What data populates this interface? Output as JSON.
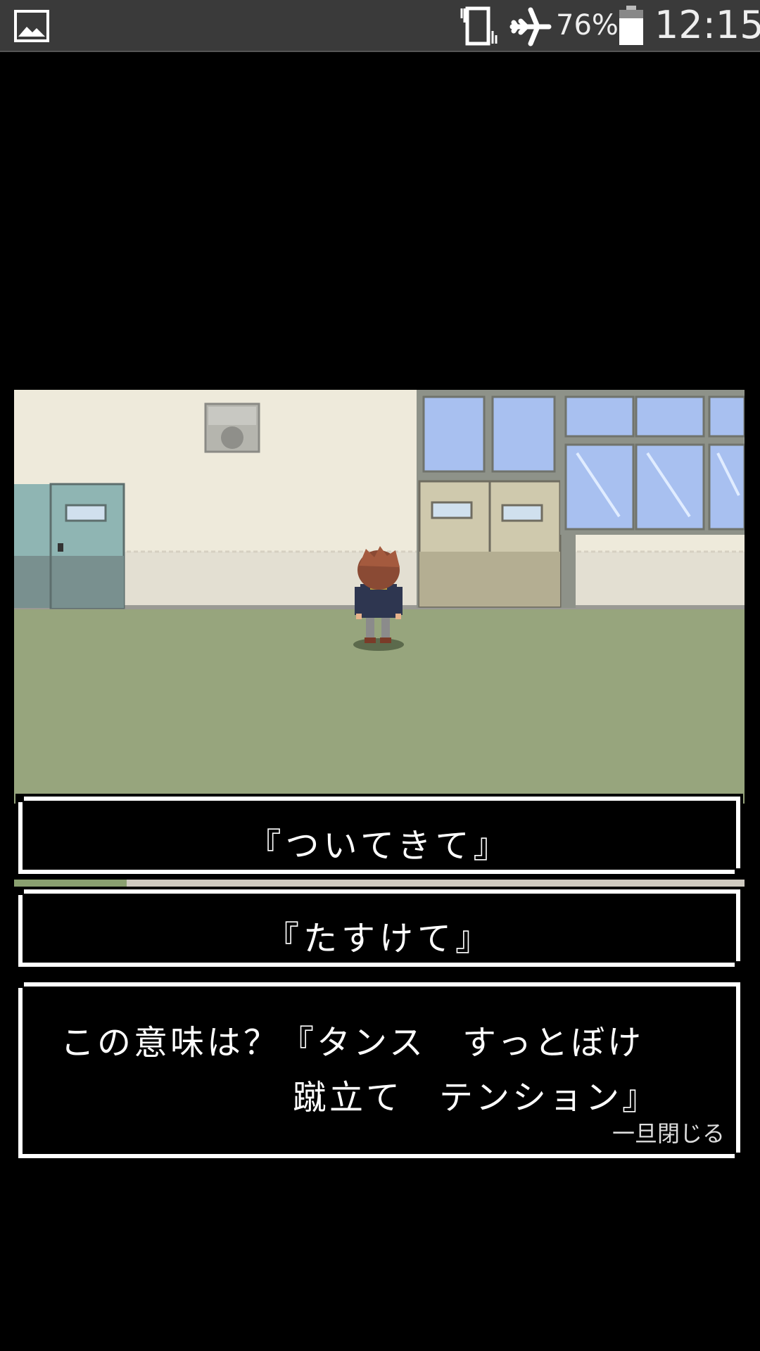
{
  "status_bar": {
    "battery_percent": "76%",
    "time": "12:15",
    "icons": [
      "gallery-icon",
      "vibrate-icon",
      "airplane-icon",
      "battery-icon"
    ]
  },
  "dialog": {
    "choices": [
      "『ついてきて』",
      "『たすけて』"
    ],
    "message_line1": "この意味は？『タンス　すっとぼけ",
    "message_line2": "蹴立て　テンション』",
    "close_hint": "一旦閉じる"
  },
  "colors": {
    "status_bar_bg": "#3a3a3a",
    "wall": "#eeeadb",
    "floor": "#97a57d",
    "window_glass": "#a8c0f0",
    "dialog_border": "#ffffff",
    "dialog_bg": "#000000"
  }
}
